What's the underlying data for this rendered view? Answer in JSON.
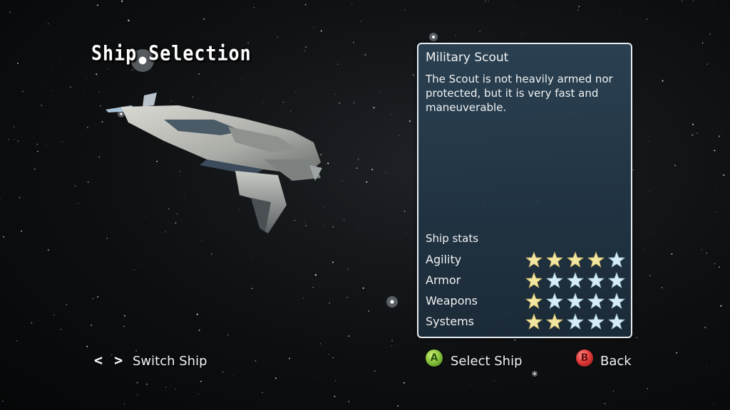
{
  "screen": {
    "title": "Ship Selection"
  },
  "ship_panel": {
    "name": "Military Scout",
    "description": "The Scout is not heavily armed nor protected, but it is very fast and maneuverable.",
    "stats_heading": "Ship stats",
    "max_stars": 5,
    "stats": [
      {
        "label": "Agility",
        "filled": 4
      },
      {
        "label": "Armor",
        "filled": 1
      },
      {
        "label": "Weapons",
        "filled": 1
      },
      {
        "label": "Systems",
        "filled": 2
      }
    ]
  },
  "footer": {
    "switch_arrows": "< >",
    "switch_label": "Switch Ship",
    "select_button": "A",
    "select_label": "Select Ship",
    "back_button": "B",
    "back_label": "Back"
  },
  "colors": {
    "star_filled": "#f3e6a0",
    "star_empty": "#d6ecf6"
  }
}
